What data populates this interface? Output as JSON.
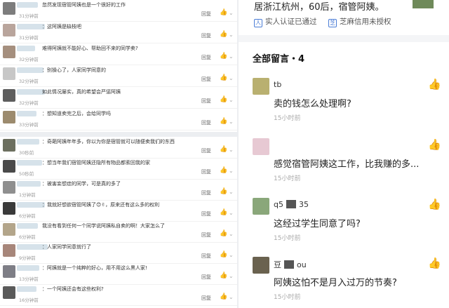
{
  "left_top": {
    "reply_label": "回复",
    "comments": [
      {
        "text": "忽然发现宿管阿姨也是一个很好的工作",
        "time": "31分钟前"
      },
      {
        "text": "：这阿姨是缺枝吧",
        "time": "31分钟前"
      },
      {
        "text": "难得阿姨就不能好心、帮助回不来的同学卖?",
        "time": "32分钟前"
      },
      {
        "text": "：别操心了，人家同学同意的",
        "time": "32分钟前"
      },
      {
        "text": "如此情况屡实，真的希望会严惩阿姨",
        "time": "32分钟前"
      },
      {
        "text": "：想知道卖完之后，会给同学吗",
        "time": "33分钟前"
      }
    ]
  },
  "left_bottom": {
    "reply_label": "回复",
    "comments": [
      {
        "text": "：奇葩阿姨年年多，你以为你是宿管就可以随便卖我们的东西",
        "time": "30秒前"
      },
      {
        "text": "：想当年我们宿管阿姨还隐所有物品都索回我的家",
        "time": "50秒前"
      },
      {
        "text": "：被害妄想症的同学，可是真的多了",
        "time": "1分钟前"
      },
      {
        "text": "：我就好想欲宿管阿姨了😊✌，原来还有这么多的权利",
        "time": "6分钟前"
      },
      {
        "text": "我没有看到任何一个同学说阿姨私自卖的啊！大家怎么了",
        "time": "6分钟前"
      },
      {
        "text": "：人家同学同意就行了",
        "time": "9分钟前"
      },
      {
        "text": "：阿姨就是一个纯粹的好心，用不用这么黑人家!",
        "time": "13分钟前"
      },
      {
        "text": "：一个阿姨还会有这些权利?",
        "time": "16分钟前"
      }
    ]
  },
  "right": {
    "profile_line": "居浙江杭州，60后，宿管阿姨。",
    "badge_verified": "实人认证已通过",
    "badge_credit": "芝麻信用未授权",
    "all_comments_title": "全部留言・4",
    "comments": [
      {
        "name": "tb",
        "name_suffix": "",
        "text": "卖的钱怎么处理啊?",
        "time": "15小时前"
      },
      {
        "name": "",
        "name_suffix": "",
        "text": "感觉宿管阿姨这工作，比我赚的多...",
        "time": "15小时前"
      },
      {
        "name": "q5",
        "name_suffix": "35",
        "text": "这经过学生同意了吗?",
        "time": "15小时前"
      },
      {
        "name": "豆",
        "name_suffix": "ou",
        "text": "阿姨这怕不是月入过万的节奏?",
        "time": "15小时前"
      }
    ]
  }
}
